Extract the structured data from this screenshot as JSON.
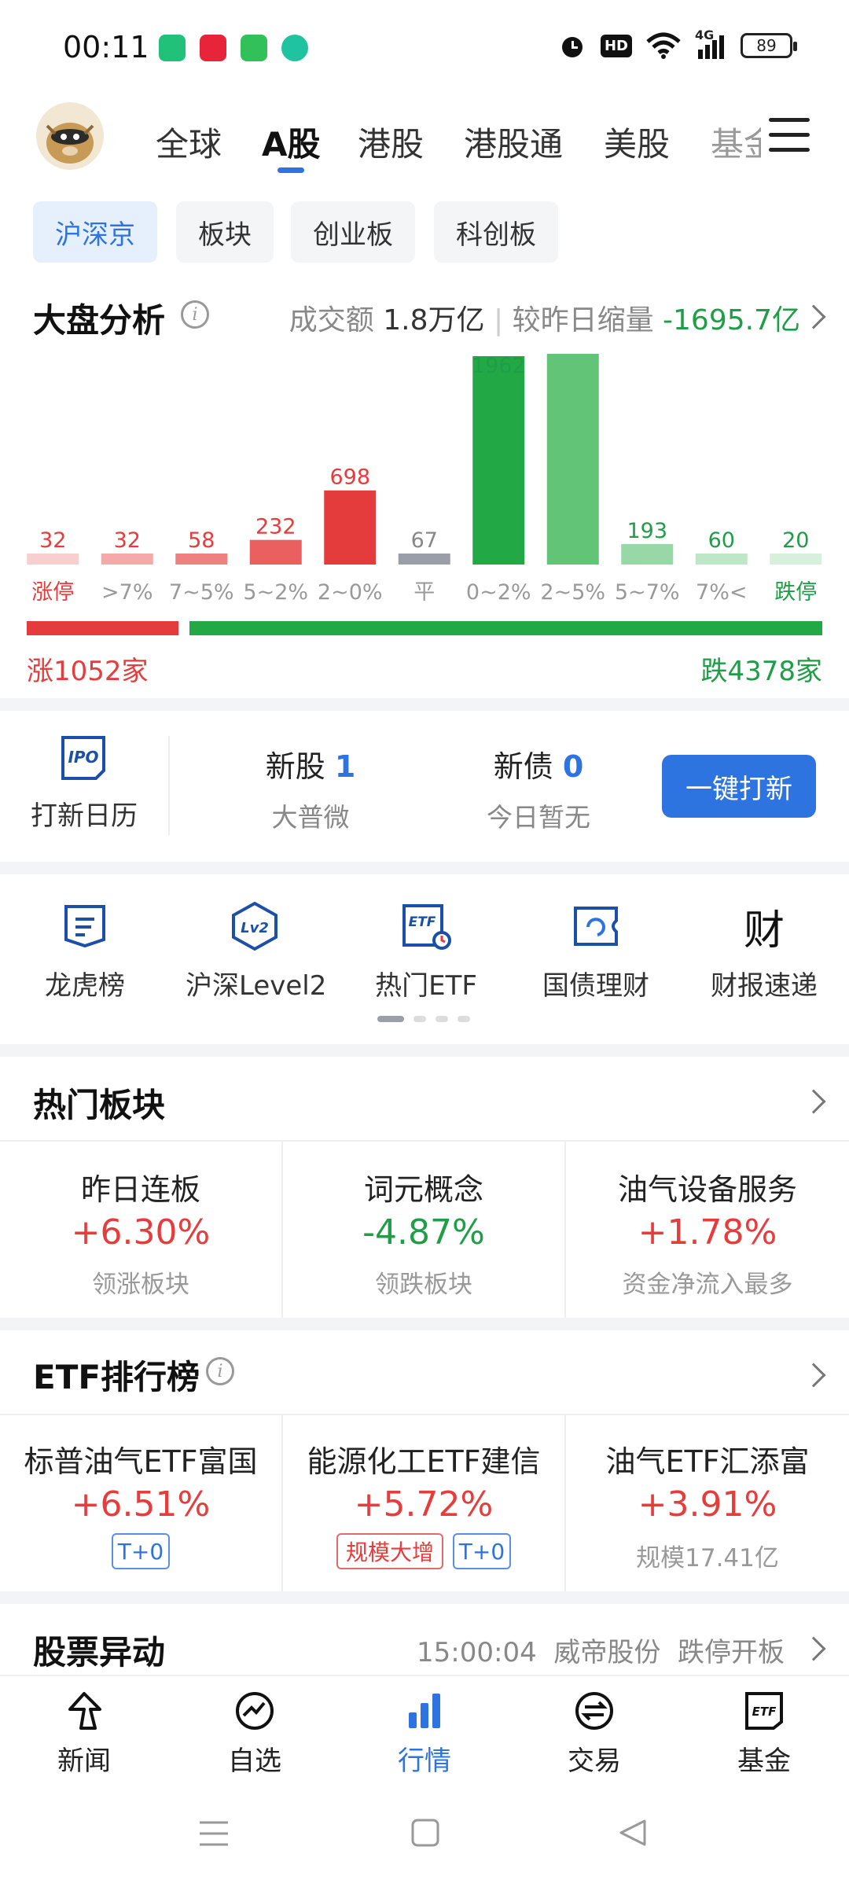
{
  "status_bar": {
    "time": "00:11",
    "network": "4G",
    "hd": "HD",
    "battery": "89"
  },
  "top_nav": {
    "tabs": [
      {
        "label": "全球"
      },
      {
        "label": "A股"
      },
      {
        "label": "港股"
      },
      {
        "label": "港股通"
      },
      {
        "label": "美股"
      },
      {
        "label": "基金"
      }
    ],
    "active": "A股"
  },
  "sub_tabs": [
    {
      "label": "沪深京"
    },
    {
      "label": "板块"
    },
    {
      "label": "创业板"
    },
    {
      "label": "科创板"
    }
  ],
  "market": {
    "title": "大盘分析",
    "turnover_label": "成交额",
    "turnover_value": "1.8万亿",
    "compare_label": "较昨日缩量",
    "compare_value": "-1695.7亿",
    "up_summary": "涨1052家",
    "down_summary": "跌4378家",
    "up_count": 1052,
    "down_count": 4378
  },
  "chart_data": {
    "type": "bar",
    "categories": [
      "涨停",
      ">7%",
      "7~5%",
      "5~2%",
      "2~0%",
      "平",
      "0~2%",
      "2~5%",
      "5~7%",
      "7%<",
      "跌停"
    ],
    "values": [
      32,
      32,
      58,
      232,
      698,
      67,
      1962,
      null,
      193,
      60,
      20
    ],
    "value_labels": [
      "32",
      "32",
      "58",
      "232",
      "698",
      "67",
      "1962",
      "",
      "193",
      "60",
      "20"
    ],
    "colors": [
      "#f7cfcf",
      "#f5a9a9",
      "#ef8080",
      "#ea5f5f",
      "#e43c3c",
      "#9a9ea8",
      "#22a845",
      "#62c476",
      "#97d8a6",
      "#bde7c6",
      "#d7f0dc"
    ],
    "label_colors": [
      "red",
      "red",
      "red",
      "red",
      "red",
      "gray",
      "green",
      "green",
      "green",
      "green",
      "green"
    ]
  },
  "ipo": {
    "calendar_label": "打新日历",
    "ipo_icon_text": "IPO",
    "stock_label": "新股",
    "stock_count": "1",
    "stock_name": "大普微",
    "bond_label": "新债",
    "bond_count": "0",
    "bond_note": "今日暂无",
    "button": "一键打新"
  },
  "shortcuts": [
    {
      "label": "龙虎榜",
      "icon": "list-icon"
    },
    {
      "label": "沪深Level2",
      "icon": "lv2-icon",
      "icon_text": "Lv2"
    },
    {
      "label": "热门ETF",
      "icon": "etf-icon",
      "icon_text": "ETF"
    },
    {
      "label": "国债理财",
      "icon": "bond-icon"
    },
    {
      "label": "财报速递",
      "icon": "report-icon",
      "icon_text": "财"
    }
  ],
  "hot_sectors": {
    "title": "热门板块",
    "items": [
      {
        "name": "昨日连板",
        "change": "+6.30%",
        "note": "领涨板块"
      },
      {
        "name": "词元概念",
        "change": "-4.87%",
        "note": "领跌板块"
      },
      {
        "name": "油气设备服务",
        "change": "+1.78%",
        "note": "资金净流入最多"
      }
    ]
  },
  "etf_rank": {
    "title": "ETF排行榜",
    "items": [
      {
        "name": "标普油气ETF富国",
        "change": "+6.51%",
        "tags": [
          "T+0"
        ]
      },
      {
        "name": "能源化工ETF建信",
        "change": "+5.72%",
        "tags": [
          "规模大增",
          "T+0"
        ]
      },
      {
        "name": "油气ETF汇添富",
        "change": "+3.91%",
        "note": "规模17.41亿"
      }
    ]
  },
  "stock_alert": {
    "title": "股票异动",
    "time": "15:00:04",
    "stock": "威帝股份",
    "event": "跌停开板"
  },
  "bottom_nav": [
    {
      "label": "新闻",
      "icon": "news-icon"
    },
    {
      "label": "自选",
      "icon": "watchlist-icon"
    },
    {
      "label": "行情",
      "icon": "market-icon"
    },
    {
      "label": "交易",
      "icon": "trade-icon"
    },
    {
      "label": "基金",
      "icon": "fund-icon",
      "icon_text": "ETF"
    }
  ],
  "colors": {
    "accent": "#2d74e0",
    "up": "#e63c3c",
    "down": "#1f9e47"
  }
}
